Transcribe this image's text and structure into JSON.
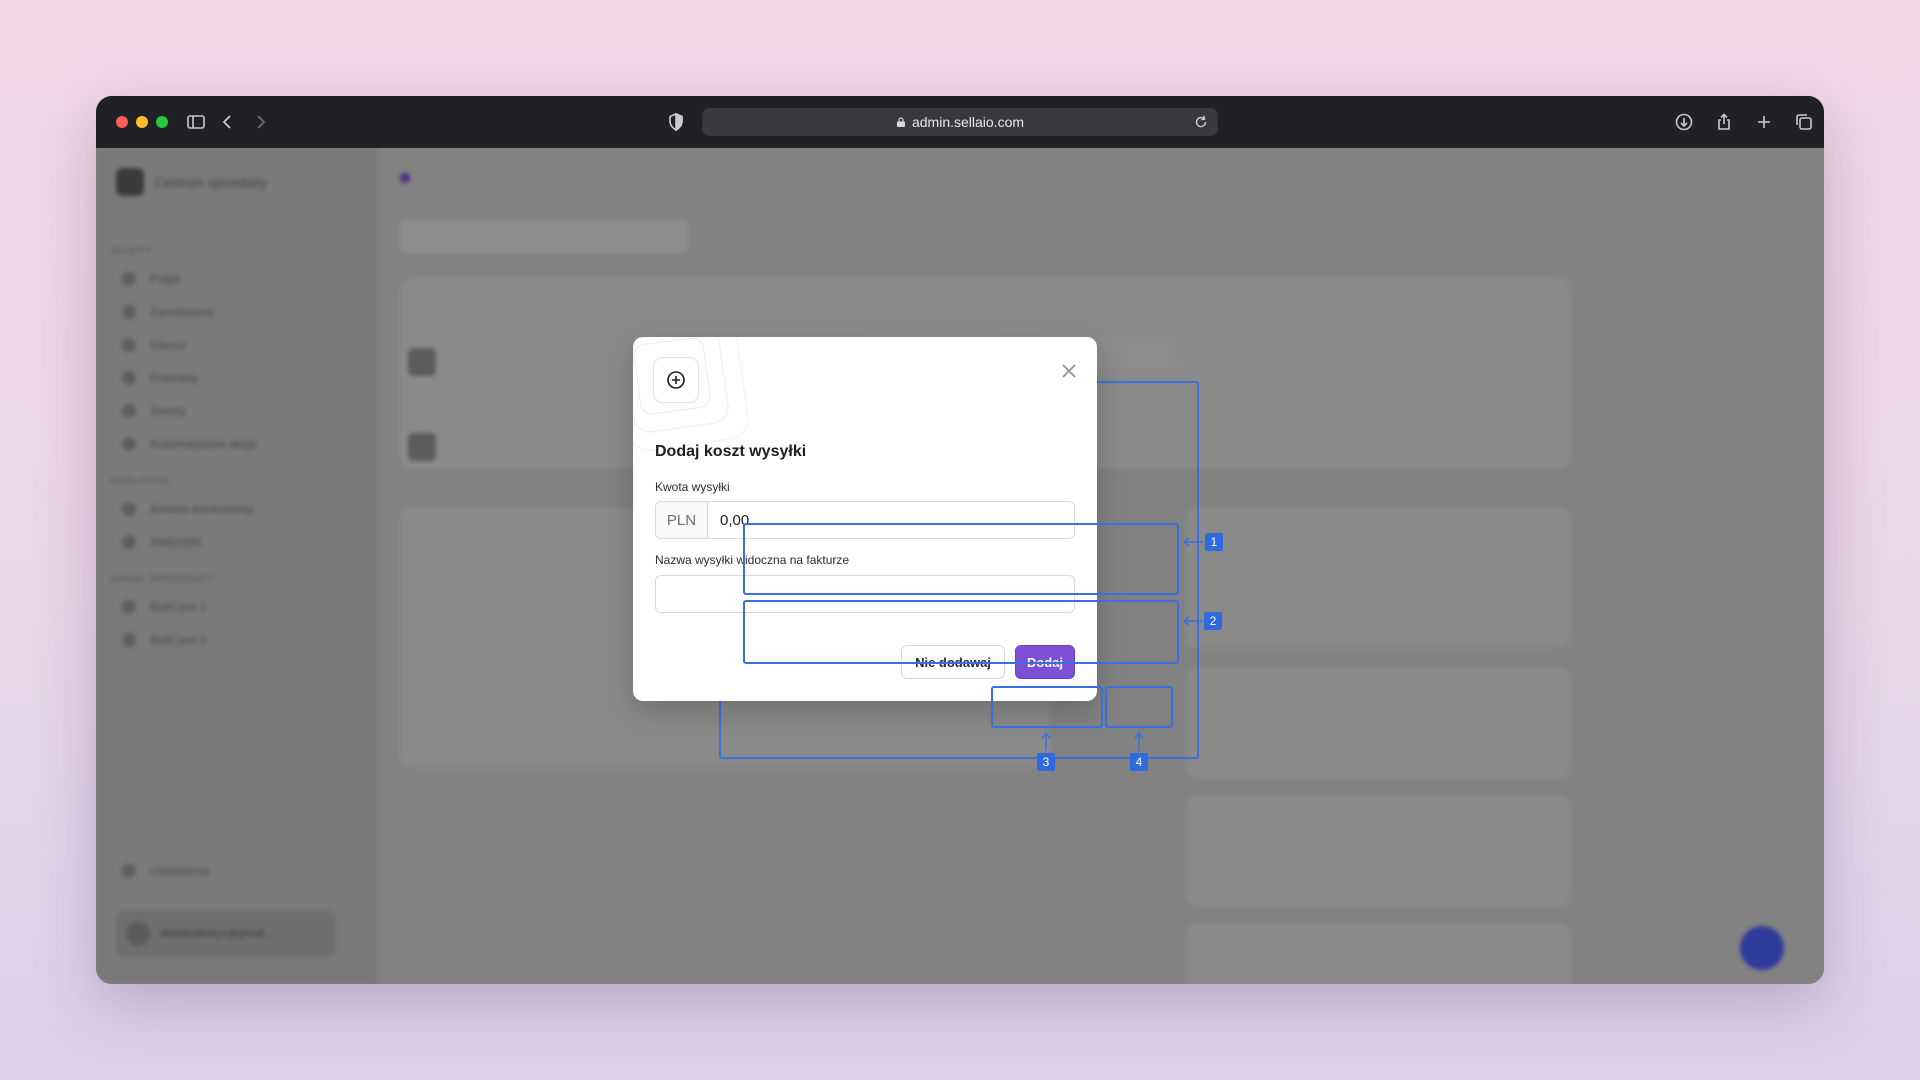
{
  "browser": {
    "url": "admin.sellaio.com",
    "traffic_lights": [
      "#fe5f57",
      "#febc2e",
      "#28c840"
    ]
  },
  "background_app": {
    "brand": "Centrum sprzedaży",
    "sidebar_sections": [
      {
        "title": "SKLEPY",
        "items": [
          "Pulpit",
          "Zamówienia",
          "Klienci",
          "Produkty",
          "Zwroty",
          "Automatyczne akcje"
        ]
      },
      {
        "title": "ANALITYKA",
        "items": [
          "Analiza konkurencji",
          "Statystyki"
        ]
      },
      {
        "title": "KANAŁ SPRZEDAŻY",
        "items": [
          "BaliCard 1",
          "BaliCard 2"
        ]
      }
    ],
    "settings_label": "Ustawienia",
    "user_label": "sklepbaliney1@gmail..."
  },
  "modal": {
    "title": "Dodaj koszt wysyłki",
    "amount_label": "Kwota wysyłki",
    "currency": "PLN",
    "amount_value": "0,00",
    "name_label": "Nazwa wysyłki widoczna na fakturze",
    "name_value": "",
    "cancel_label": "Nie dodawaj",
    "submit_label": "Dodaj",
    "accent_color": "#7b4fd6"
  },
  "annotations": [
    "1",
    "2",
    "3",
    "4"
  ]
}
